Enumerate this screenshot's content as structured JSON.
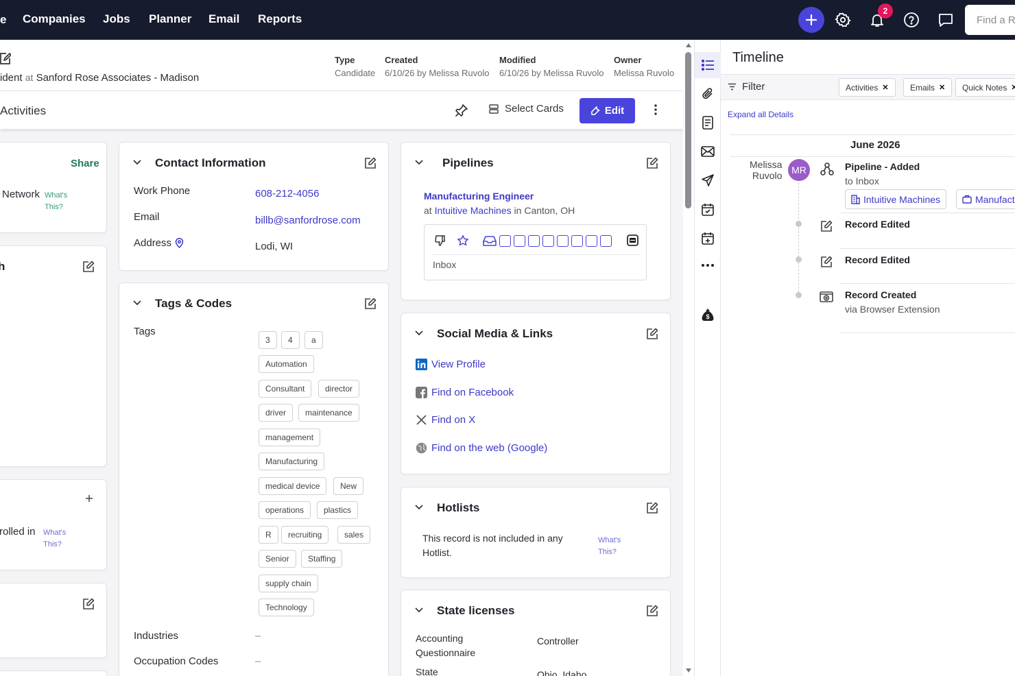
{
  "nav": {
    "edge_fragment": "e",
    "items": [
      "Companies",
      "Jobs",
      "Planner",
      "Email",
      "Reports"
    ],
    "notification_count": "2",
    "search_placeholder": "Find a Record"
  },
  "record": {
    "subtitle_prefix": "ident",
    "subtitle_at": "at",
    "company": "Sanford Rose Associates - Madison",
    "meta": [
      {
        "label": "Type",
        "value": "Candidate"
      },
      {
        "label": "Created",
        "value": "6/10/26 by Melissa Ruvolo"
      },
      {
        "label": "Modified",
        "value": "6/10/26 by Melissa Ruvolo"
      },
      {
        "label": "Owner",
        "value": "Melissa Ruvolo"
      }
    ]
  },
  "toolbar": {
    "activities_label": "Activities",
    "select_cards_label": "Select Cards",
    "edit_label": "Edit"
  },
  "left_cards": {
    "share_label": "Share",
    "network_label": "Network",
    "whats_this": "What's This?",
    "h_fragment": "h",
    "enrolled_fragment": "rolled in"
  },
  "contact": {
    "title": "Contact Information",
    "rows": [
      {
        "label": "Work Phone",
        "value": "608-212-4056"
      },
      {
        "label": "Email",
        "value": "billb@sanfordrose.com"
      },
      {
        "label": "Address",
        "value": "Lodi, WI"
      }
    ]
  },
  "tags_codes": {
    "title": "Tags & Codes",
    "tags_label": "Tags",
    "tags": [
      "3",
      "4",
      "a",
      "Automation",
      "Consultant",
      "director",
      "driver",
      "maintenance",
      "management",
      "Manufacturing",
      "medical device",
      "New",
      "operations",
      "plastics",
      "R",
      "recruiting",
      "sales",
      "Senior",
      "Staffing",
      "supply chain",
      "Technology"
    ],
    "industries_label": "Industries",
    "industries_value": "–",
    "occupation_label": "Occupation Codes",
    "occupation_value": "–"
  },
  "pipelines": {
    "title": "Pipelines",
    "job_title": "Manufacturing Engineer",
    "at": "at",
    "company": "Intuitive Machines",
    "in": "in",
    "location": "Canton, OH",
    "stage": "Inbox"
  },
  "social": {
    "title": "Social Media & Links",
    "links": [
      "View Profile",
      "Find on Facebook",
      "Find on X",
      "Find on the web (Google)"
    ]
  },
  "hotlists": {
    "title": "Hotlists",
    "text": "This record is not included in any Hotlist.",
    "whats_this": "What's This?"
  },
  "state_licenses": {
    "title": "State licenses",
    "rows": [
      {
        "label": "Accounting Questionnaire",
        "value": "Controller"
      },
      {
        "label": "State",
        "value": "Ohio, Idaho"
      }
    ]
  },
  "timeline": {
    "title": "Timeline",
    "filter_label": "Filter",
    "chips": [
      "Activities",
      "Emails",
      "Quick Notes"
    ],
    "expand_label": "Expand all Details",
    "month": "June 2026",
    "user_first": "Melissa",
    "user_last": "Ruvolo",
    "avatar_initials": "MR",
    "events": [
      {
        "title": "Pipeline - Added",
        "sub": "to Inbox"
      },
      {
        "title": "Record Edited",
        "sub": ""
      },
      {
        "title": "Record Edited",
        "sub": ""
      },
      {
        "title": "Record Created",
        "sub": "via Browser Extension"
      }
    ],
    "links": [
      "Intuitive Machines",
      "Manufacturing Engineer"
    ]
  },
  "colors": {
    "nav_bg": "#161b2e",
    "accent": "#4a44dd",
    "link": "#3d38c7",
    "badge": "#e5175c",
    "avatar": "#9a5cc8",
    "share_green": "#1f7a5a"
  }
}
